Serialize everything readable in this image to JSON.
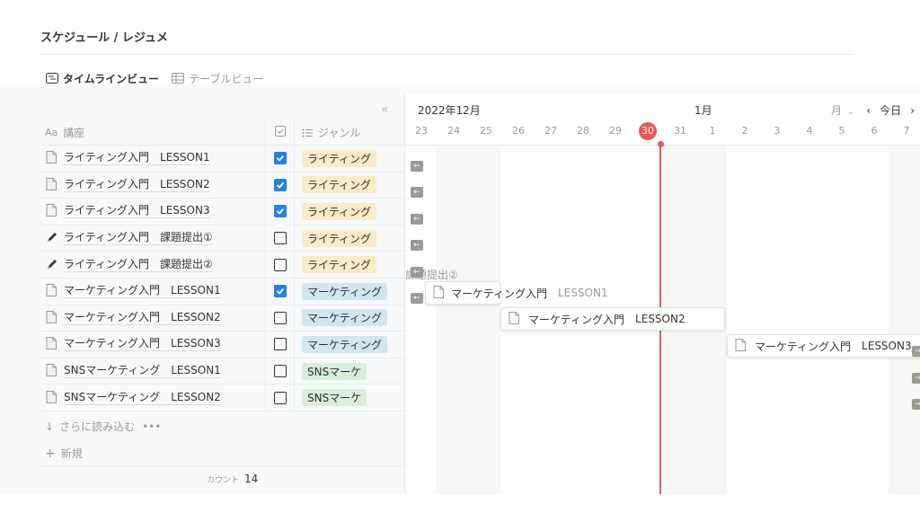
{
  "page": {
    "title": "スケジュール / レジュメ"
  },
  "tabs": [
    {
      "label": "タイムラインビュー",
      "icon": "timeline-icon",
      "active": true
    },
    {
      "label": "テーブルビュー",
      "icon": "table-icon",
      "active": false
    }
  ],
  "table": {
    "headers": {
      "name_prefix": "Aa",
      "name": "講座",
      "genre": "ジャンル"
    },
    "rows": [
      {
        "name": "ライティング入門　LESSON1",
        "icon": "page-icon",
        "checked": true,
        "genre": "ライティング",
        "genre_type": "writing"
      },
      {
        "name": "ライティング入門　LESSON2",
        "icon": "page-icon",
        "checked": true,
        "genre": "ライティング",
        "genre_type": "writing"
      },
      {
        "name": "ライティング入門　LESSON3",
        "icon": "page-icon",
        "checked": true,
        "genre": "ライティング",
        "genre_type": "writing"
      },
      {
        "name": "ライティング入門　課題提出①",
        "icon": "pen-icon",
        "checked": false,
        "genre": "ライティング",
        "genre_type": "writing"
      },
      {
        "name": "ライティング入門　課題提出②",
        "icon": "pen-icon",
        "checked": false,
        "genre": "ライティング",
        "genre_type": "writing"
      },
      {
        "name": "マーケティング入門　LESSON1",
        "icon": "page-icon",
        "checked": true,
        "genre": "マーケティング",
        "genre_type": "marketing"
      },
      {
        "name": "マーケティング入門　LESSON2",
        "icon": "page-icon",
        "checked": false,
        "genre": "マーケティング",
        "genre_type": "marketing"
      },
      {
        "name": "マーケティング入門　LESSON3",
        "icon": "page-icon",
        "checked": false,
        "genre": "マーケティング",
        "genre_type": "marketing"
      },
      {
        "name": "SNSマーケティング　LESSON1",
        "icon": "page-icon",
        "checked": false,
        "genre": "SNSマーケ",
        "genre_type": "sns"
      },
      {
        "name": "SNSマーケティング　LESSON2",
        "icon": "page-icon",
        "checked": false,
        "genre": "SNSマーケ",
        "genre_type": "sns"
      }
    ],
    "load_more": "さらに読み込む",
    "new_label": "新規",
    "count_label": "カウント",
    "count_value": "14"
  },
  "timeline": {
    "month_left": "2022年12月",
    "month_right": "1月",
    "view_mode": "月",
    "today_label": "今日",
    "days": [
      "23",
      "24",
      "25",
      "26",
      "27",
      "28",
      "29",
      "30",
      "31",
      "1",
      "2",
      "3",
      "4",
      "5",
      "6",
      "7"
    ],
    "today": "30",
    "bars": [
      {
        "title": "マーケティング入門",
        "suffix": "LESSON1"
      },
      {
        "title": "マーケティング入門",
        "suffix": "LESSON2"
      },
      {
        "title": "マーケティング入門",
        "suffix": "LESSON3"
      }
    ],
    "ghost_label": "課題提出②"
  },
  "colors": {
    "accent": "#2383e2",
    "today": "#eb5757",
    "writing": "#fbecc9",
    "marketing": "#d3e5ef",
    "sns": "#dbeddb"
  }
}
